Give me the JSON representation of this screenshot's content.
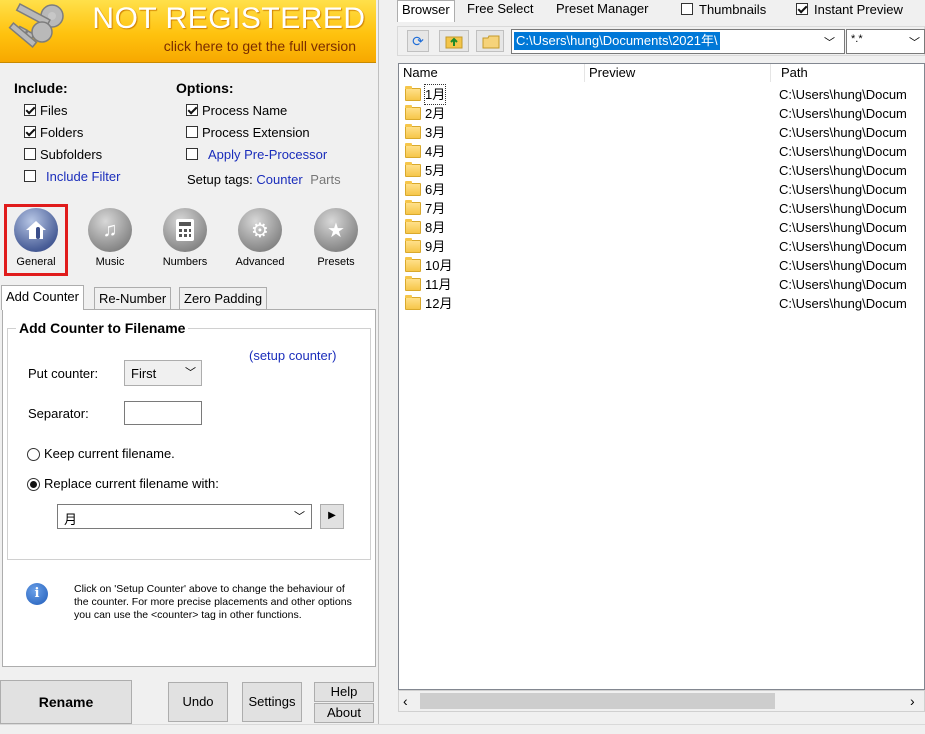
{
  "banner": {
    "title": "NOT REGISTERED",
    "subtitle": "click here to get the full version"
  },
  "include": {
    "title": "Include:",
    "items": [
      {
        "label": "Files",
        "checked": true
      },
      {
        "label": "Folders",
        "checked": true
      },
      {
        "label": "Subfolders",
        "checked": false
      },
      {
        "label": "Include Filter",
        "checked": false,
        "link": true
      }
    ]
  },
  "options": {
    "title": "Options:",
    "items": [
      {
        "label": "Process Name",
        "checked": true
      },
      {
        "label": "Process Extension",
        "checked": false
      },
      {
        "label": "Apply Pre-Processor",
        "checked": false,
        "link": true
      }
    ],
    "setup_tags_label": "Setup tags:",
    "setup_tags_counter": "Counter",
    "setup_tags_parts": "Parts"
  },
  "categories": [
    {
      "label": "General",
      "icon": "home-hand-icon",
      "selected": true
    },
    {
      "label": "Music",
      "icon": "music-note-icon",
      "selected": false
    },
    {
      "label": "Numbers",
      "icon": "calculator-icon",
      "selected": false
    },
    {
      "label": "Advanced",
      "icon": "gear-icon",
      "selected": false
    },
    {
      "label": "Presets",
      "icon": "star-icon",
      "selected": false
    }
  ],
  "tabs": [
    "Add Counter",
    "Re-Number",
    "Zero Padding"
  ],
  "add_counter": {
    "group_title": "Add Counter to Filename",
    "setup_link": "(setup counter)",
    "put_counter_label": "Put counter:",
    "put_counter_value": "First",
    "separator_label": "Separator:",
    "separator_value": "",
    "keep_label": "Keep current filename.",
    "replace_label": "Replace current filename with:",
    "replace_value": "月",
    "selected_option": "replace"
  },
  "info_text": "Click on 'Setup Counter' above to change the behaviour of the counter. For more precise placements and other options you can use the <counter> tag in other functions.",
  "bottom_buttons": {
    "rename": "Rename",
    "undo": "Undo",
    "settings": "Settings",
    "help": "Help",
    "about": "About"
  },
  "browser_tabs": [
    {
      "label": "Browser",
      "active": true
    },
    {
      "label": "Free Select",
      "active": false
    },
    {
      "label": "Preset Manager",
      "active": false
    }
  ],
  "view_options": [
    {
      "label": "Thumbnails",
      "checked": false
    },
    {
      "label": "Instant Preview",
      "checked": true
    }
  ],
  "path_bar": {
    "path": "C:\\Users\\hung\\Documents\\2021年\\",
    "filter": "*.*"
  },
  "columns": [
    "Name",
    "Preview",
    "Path"
  ],
  "files": [
    {
      "name": "1月",
      "path": "C:\\Users\\hung\\Docum"
    },
    {
      "name": "2月",
      "path": "C:\\Users\\hung\\Docum"
    },
    {
      "name": "3月",
      "path": "C:\\Users\\hung\\Docum"
    },
    {
      "name": "4月",
      "path": "C:\\Users\\hung\\Docum"
    },
    {
      "name": "5月",
      "path": "C:\\Users\\hung\\Docum"
    },
    {
      "name": "6月",
      "path": "C:\\Users\\hung\\Docum"
    },
    {
      "name": "7月",
      "path": "C:\\Users\\hung\\Docum"
    },
    {
      "name": "8月",
      "path": "C:\\Users\\hung\\Docum"
    },
    {
      "name": "9月",
      "path": "C:\\Users\\hung\\Docum"
    },
    {
      "name": "10月",
      "path": "C:\\Users\\hung\\Docum"
    },
    {
      "name": "11月",
      "path": "C:\\Users\\hung\\Docum"
    },
    {
      "name": "12月",
      "path": "C:\\Users\\hung\\Docum"
    }
  ],
  "colors": {
    "banner": "#ffc20e",
    "link": "#1a2dbb",
    "path_highlight": "#0078d7",
    "selected_frame": "#e01b1b"
  }
}
